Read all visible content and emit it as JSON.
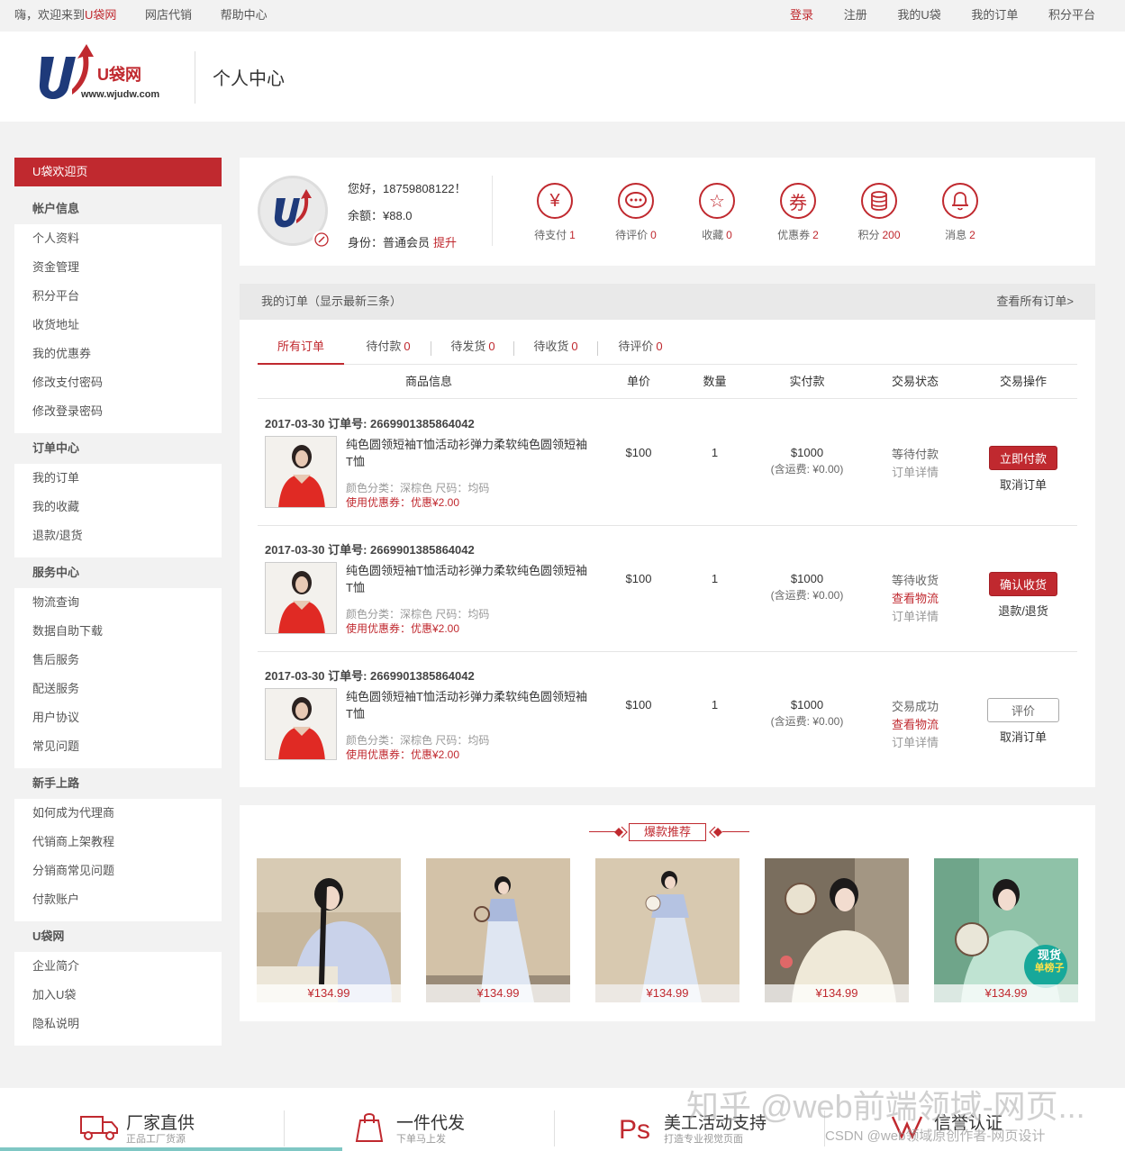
{
  "topbar": {
    "greeting_prefix": "嗨，欢迎来到",
    "greeting_brand": "U袋网",
    "left_links": [
      "网店代销",
      "帮助中心"
    ],
    "login": "登录",
    "right_links": [
      "注册",
      "我的U袋",
      "我的订单",
      "积分平台"
    ]
  },
  "header": {
    "logo_brand": "U袋网",
    "logo_site": "www.wjudw.com",
    "page_title": "个人中心"
  },
  "sidebar": {
    "home": "U袋欢迎页",
    "groups": [
      {
        "title": "帐户信息",
        "items": [
          "个人资料",
          "资金管理",
          "积分平台",
          "收货地址",
          "我的优惠券",
          "修改支付密码",
          "修改登录密码"
        ]
      },
      {
        "title": "订单中心",
        "items": [
          "我的订单",
          "我的收藏",
          "退款/退货"
        ]
      },
      {
        "title": "服务中心",
        "items": [
          "物流查询",
          "数据自助下载",
          "售后服务",
          "配送服务",
          "用户协议",
          "常见问题"
        ]
      },
      {
        "title": "新手上路",
        "items": [
          "如何成为代理商",
          "代销商上架教程",
          "分销商常见问题",
          "付款账户"
        ]
      },
      {
        "title": "U袋网",
        "items": [
          "企业简介",
          "加入U袋",
          "隐私说明"
        ]
      }
    ]
  },
  "user": {
    "greeting": "您好，18759808122！",
    "balance": "余额：¥88.0",
    "identity_label": "身份：普通会员",
    "upgrade": "提升",
    "stats": [
      {
        "icon": "yen-icon",
        "glyph": "¥",
        "label": "待支付",
        "value": "1"
      },
      {
        "icon": "chat-icon",
        "glyph": "…",
        "label": "待评价",
        "value": "0"
      },
      {
        "icon": "star-icon",
        "glyph": "☆",
        "label": "收藏",
        "value": "0"
      },
      {
        "icon": "coupon-icon",
        "glyph": "券",
        "label": "优惠券",
        "value": "2"
      },
      {
        "icon": "coins-icon",
        "glyph": "≋",
        "label": "积分",
        "value": "200"
      },
      {
        "icon": "bell-icon",
        "glyph": "🔔",
        "label": "消息",
        "value": "2"
      }
    ]
  },
  "orders": {
    "title": "我的订单（显示最新三条）",
    "view_all": "查看所有订单>",
    "tabs": [
      {
        "label": "所有订单",
        "value": ""
      },
      {
        "label": "待付款",
        "value": "0"
      },
      {
        "label": "待发货",
        "value": "0"
      },
      {
        "label": "待收货",
        "value": "0"
      },
      {
        "label": "待评价",
        "value": "0"
      }
    ],
    "columns": [
      "商品信息",
      "单价",
      "数量",
      "实付款",
      "交易状态",
      "交易操作"
    ],
    "rows": [
      {
        "header": "2017-03-30 订单号: 2669901385864042",
        "name": "纯色圆领短袖T恤活动衫弹力柔软纯色圆领短袖T恤",
        "attrs": "颜色分类：深棕色  尺码：均码",
        "coupon": "使用优惠券：优惠¥2.00",
        "price": "$100",
        "qty": "1",
        "paid": "$1000",
        "shipping": "(含运费: ¥0.00)",
        "status": [
          "等待付款",
          "订单详情"
        ],
        "action": "立即付款",
        "action_style": "red",
        "sub_action": "取消订单"
      },
      {
        "header": "2017-03-30 订单号: 2669901385864042",
        "name": "纯色圆领短袖T恤活动衫弹力柔软纯色圆领短袖T恤",
        "attrs": "颜色分类：深棕色  尺码：均码",
        "coupon": "使用优惠券：优惠¥2.00",
        "price": "$100",
        "qty": "1",
        "paid": "$1000",
        "shipping": "(含运费: ¥0.00)",
        "status": [
          "等待收货",
          "查看物流",
          "订单详情"
        ],
        "action": "确认收货",
        "action_style": "red",
        "sub_action": "退款/退货"
      },
      {
        "header": "2017-03-30 订单号: 2669901385864042",
        "name": "纯色圆领短袖T恤活动衫弹力柔软纯色圆领短袖T恤",
        "attrs": "颜色分类：深棕色  尺码：均码",
        "coupon": "使用优惠券：优惠¥2.00",
        "price": "$100",
        "qty": "1",
        "paid": "$1000",
        "shipping": "(含运费: ¥0.00)",
        "status": [
          "交易成功",
          "查看物流",
          "订单详情"
        ],
        "action": "评价",
        "action_style": "white",
        "sub_action": "取消订单"
      }
    ]
  },
  "recommend": {
    "title": "爆款推荐",
    "items": [
      {
        "price": "¥134.99"
      },
      {
        "price": "¥134.99"
      },
      {
        "price": "¥134.99"
      },
      {
        "price": "¥134.99"
      },
      {
        "price": "¥134.99",
        "badge_1": "现货",
        "badge_2": "单榜子"
      }
    ]
  },
  "footer": {
    "features": [
      {
        "icon": "truck-icon",
        "title": "厂家直供",
        "sub": "正品工厂货源"
      },
      {
        "icon": "bag-icon",
        "title": "一件代发",
        "sub": "下单马上发"
      },
      {
        "icon": "ps-icon",
        "title": "美工活动支持",
        "sub": "打造专业视觉页面"
      },
      {
        "icon": "shield-icon",
        "title": "信誉认证",
        "sub": ""
      }
    ]
  },
  "watermark": {
    "line1": "知乎 @web前端领域-网页...",
    "line2": "CSDN @web领域原创作者-网页设计"
  },
  "colors": {
    "accent": "#c0292f",
    "background": "#f2f2f2"
  }
}
